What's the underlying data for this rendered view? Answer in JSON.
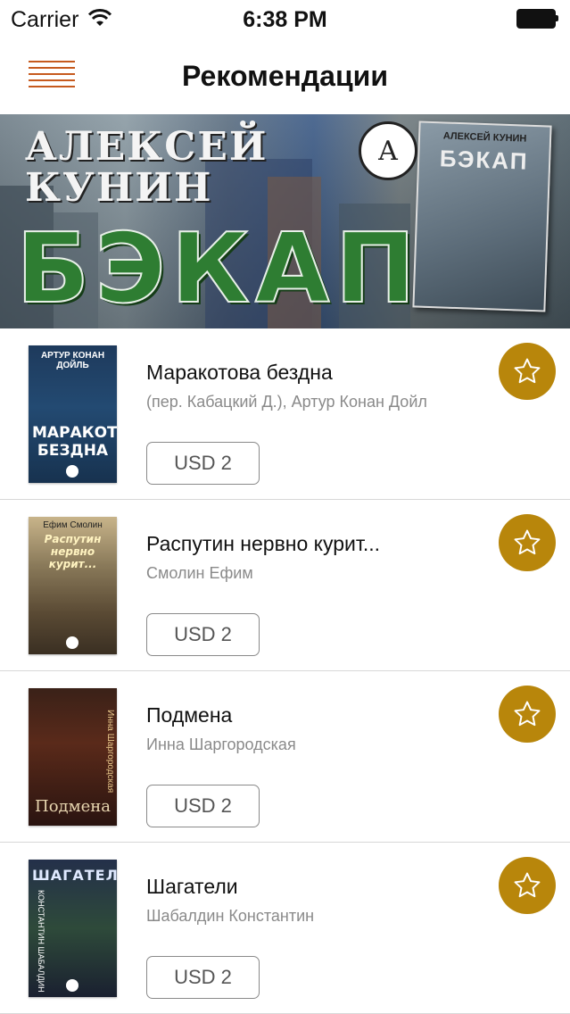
{
  "status_bar": {
    "carrier": "Carrier",
    "time": "6:38 PM"
  },
  "nav": {
    "title": "Рекомендации",
    "menu_icon": "hamburger-menu-icon",
    "accent_color": "#c65a1e"
  },
  "banner": {
    "author": "АЛЕКСЕЙ КУНИН",
    "title": "БЭКАП",
    "book_author": "АЛЕКСЕЙ КУНИН",
    "book_title": "БЭКАП",
    "seal_letter": "А"
  },
  "books": [
    {
      "title": "Маракотова бездна",
      "author": "(пер. Кабацкий Д.), Артур Конан Дойл",
      "price": "USD 2",
      "cover_author": "АРТУР КОНАН ДОЙЛЬ",
      "cover_title": "МАРАКОТОВА БЕЗДНА"
    },
    {
      "title": "Распутин нервно курит...",
      "author": "Смолин Ефим",
      "price": "USD 2",
      "cover_author": "Ефим Смолин",
      "cover_title": "Распутин нервно курит..."
    },
    {
      "title": "Подмена",
      "author": "Инна Шаргородская",
      "price": "USD 2",
      "cover_author": "Инна Шаргородская",
      "cover_title": "Подмена"
    },
    {
      "title": "Шагатели",
      "author": "Шабалдин Константин",
      "price": "USD 2",
      "cover_author": "КОНСТАНТИН ШАБАЛДИН",
      "cover_title": "ШАГАТЕЛИ"
    }
  ],
  "colors": {
    "favorite_button": "#b8860b",
    "separator": "#d8d8d8",
    "secondary_text": "#8a8a8a"
  },
  "icons": {
    "favorite": "star-outline-icon",
    "wifi": "wifi-icon",
    "battery": "battery-icon"
  }
}
